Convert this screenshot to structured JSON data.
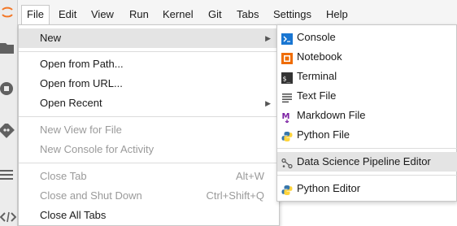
{
  "menubar": {
    "items": [
      "File",
      "Edit",
      "View",
      "Run",
      "Kernel",
      "Git",
      "Tabs",
      "Settings",
      "Help"
    ],
    "active": "File"
  },
  "file_menu": {
    "new": "New",
    "open_from_path": "Open from Path...",
    "open_from_url": "Open from URL...",
    "open_recent": "Open Recent",
    "new_view": "New View for File",
    "new_console": "New Console for Activity",
    "close_tab": "Close Tab",
    "close_tab_shortcut": "Alt+W",
    "close_shutdown": "Close and Shut Down",
    "close_shutdown_shortcut": "Ctrl+Shift+Q",
    "close_all": "Close All Tabs"
  },
  "new_submenu": {
    "console": "Console",
    "notebook": "Notebook",
    "terminal": "Terminal",
    "text_file": "Text File",
    "markdown_file": "Markdown File",
    "python_file": "Python File",
    "pipeline_editor": "Data Science Pipeline Editor",
    "python_editor": "Python Editor"
  },
  "colors": {
    "jupyter_orange": "#f37726",
    "console_blue": "#1976d2",
    "notebook_orange": "#ef6c00",
    "terminal_dark": "#333333",
    "markdown_purple": "#7b1fa2",
    "python_blue": "#3776ab",
    "python_yellow": "#ffd43b"
  },
  "activity_icons": [
    "jupyter-logo-icon",
    "folder-icon",
    "running-icon",
    "git-icon",
    "list-icon",
    "code-icon"
  ]
}
